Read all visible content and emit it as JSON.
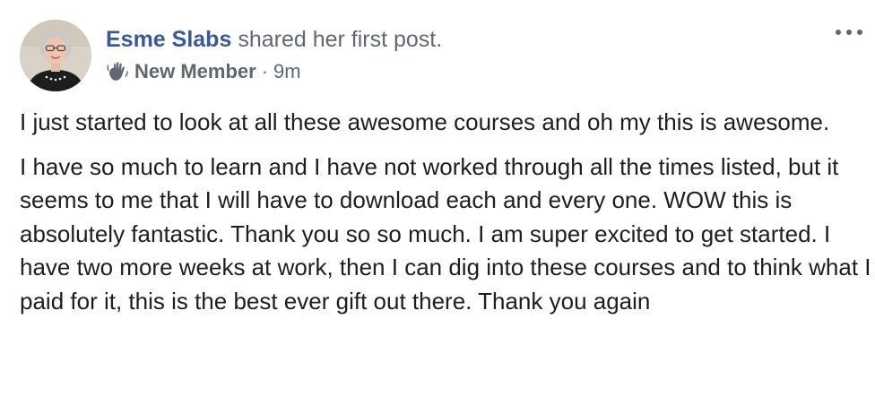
{
  "post": {
    "author_name": "Esme Slabs",
    "action_text": "shared her first post.",
    "badge_icon": "waving-hand-icon",
    "badge_label": "New Member",
    "separator": "·",
    "timestamp": "9m",
    "more_icon": "more-options-icon",
    "paragraphs": [
      "I just started to look at all these awesome courses and oh my this is awesome.",
      "I have so much to learn and I have not worked through all the times listed, but it seems to me that I will have to download each and every one. WOW this is absolutely fantastic. Thank you so so much. I am super excited to get started. I have two more weeks at work, then I can dig into these courses and to think what I paid for it, this is the best ever gift out there. Thank you again"
    ]
  },
  "colors": {
    "author_link": "#385898",
    "secondary_text": "#606770",
    "body_text": "#1c1e21"
  }
}
